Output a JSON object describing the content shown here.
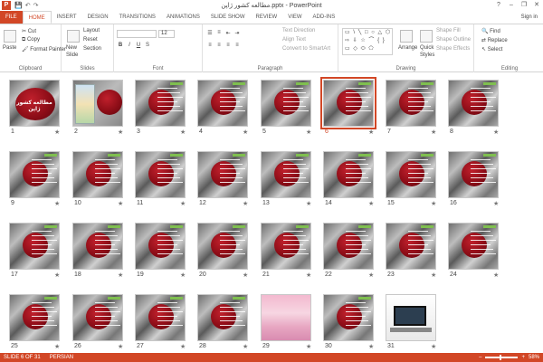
{
  "titlebar": {
    "title": "مطالعه کشور ژاپن.pptx - PowerPoint",
    "app_icon": "P",
    "qat_save": "💾",
    "qat_undo": "↶",
    "qat_redo": "↷",
    "help": "?",
    "minimize": "–",
    "restore": "❐",
    "close": "✕"
  },
  "tabs": {
    "file": "FILE",
    "items": [
      "HOME",
      "INSERT",
      "DESIGN",
      "TRANSITIONS",
      "ANIMATIONS",
      "SLIDE SHOW",
      "REVIEW",
      "VIEW",
      "ADD-INS"
    ],
    "active": "HOME",
    "signin": "Sign in"
  },
  "ribbon": {
    "clipboard": {
      "paste": "Paste",
      "cut": "Cut",
      "copy": "Copy",
      "format_painter": "Format Painter",
      "label": "Clipboard"
    },
    "slides": {
      "new_slide": "New",
      "new_slide2": "Slide",
      "layout": "Layout",
      "reset": "Reset",
      "section": "Section",
      "label": "Slides"
    },
    "font": {
      "size": "12",
      "bold": "B",
      "italic": "I",
      "underline": "U",
      "strike": "S",
      "label": "Font"
    },
    "paragraph": {
      "text_direction": "Text Direction",
      "align_text": "Align Text",
      "convert_smartart": "Convert to SmartArt",
      "label": "Paragraph"
    },
    "drawing": {
      "shapes_preview": "▭ \\ ╲ □ ○ △ ⬡ ⇨ ⇩ ☆ ⌒ { } ▭ ◇ ⬭ ⬠",
      "arrange": "Arrange",
      "quick_styles": "Quick",
      "quick_styles2": "Styles",
      "shape_fill": "Shape Fill",
      "shape_outline": "Shape Outline",
      "shape_effects": "Shape Effects",
      "label": "Drawing"
    },
    "editing": {
      "find": "Find",
      "replace": "Replace",
      "select": "Select",
      "label": "Editing"
    }
  },
  "slides": [
    {
      "num": "1",
      "kind": "title",
      "title_text": "مطالعه کشور ژاپن"
    },
    {
      "num": "2",
      "kind": "map"
    },
    {
      "num": "3",
      "kind": "text"
    },
    {
      "num": "4",
      "kind": "text"
    },
    {
      "num": "5",
      "kind": "text"
    },
    {
      "num": "6",
      "kind": "text",
      "selected": true
    },
    {
      "num": "7",
      "kind": "text"
    },
    {
      "num": "8",
      "kind": "text"
    },
    {
      "num": "9",
      "kind": "text"
    },
    {
      "num": "10",
      "kind": "text"
    },
    {
      "num": "11",
      "kind": "text"
    },
    {
      "num": "12",
      "kind": "text"
    },
    {
      "num": "13",
      "kind": "text"
    },
    {
      "num": "14",
      "kind": "text"
    },
    {
      "num": "15",
      "kind": "text"
    },
    {
      "num": "16",
      "kind": "text"
    },
    {
      "num": "17",
      "kind": "text"
    },
    {
      "num": "18",
      "kind": "text"
    },
    {
      "num": "19",
      "kind": "text"
    },
    {
      "num": "20",
      "kind": "text"
    },
    {
      "num": "21",
      "kind": "text"
    },
    {
      "num": "22",
      "kind": "text"
    },
    {
      "num": "23",
      "kind": "text"
    },
    {
      "num": "24",
      "kind": "text"
    },
    {
      "num": "25",
      "kind": "text"
    },
    {
      "num": "26",
      "kind": "text"
    },
    {
      "num": "27",
      "kind": "text"
    },
    {
      "num": "28",
      "kind": "text"
    },
    {
      "num": "29",
      "kind": "pink"
    },
    {
      "num": "30",
      "kind": "text"
    },
    {
      "num": "31",
      "kind": "laptop"
    }
  ],
  "status": {
    "slide_indicator": "SLIDE 6 OF 31",
    "language": "PERSIAN",
    "zoom": "58%",
    "zoom_out": "–",
    "zoom_in": "+"
  },
  "colors": {
    "accent": "#d24726",
    "slide_red": "#8a0c16"
  }
}
